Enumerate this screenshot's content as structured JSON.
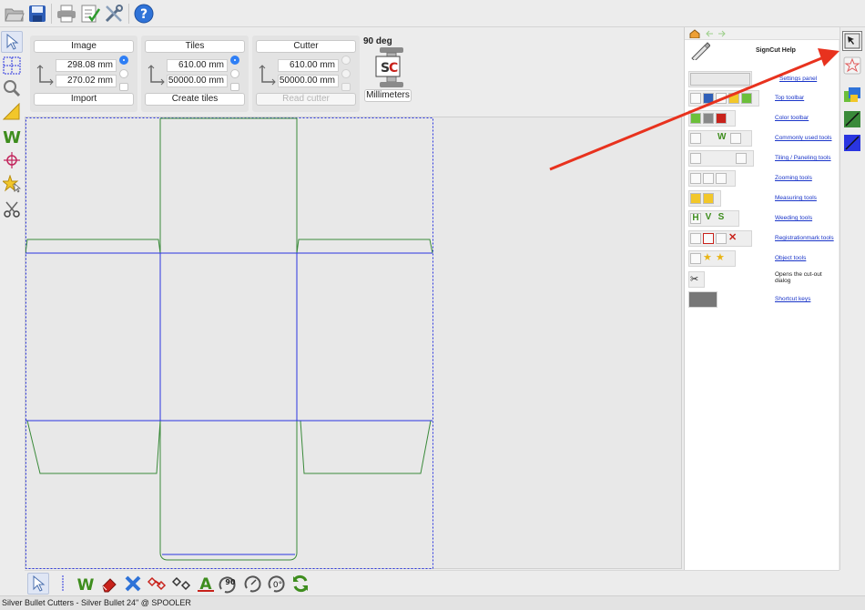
{
  "setup_panel": {
    "image": {
      "label": "Image",
      "width": "298.08 mm",
      "height": "270.02 mm",
      "action": "Import"
    },
    "tiles": {
      "label": "Tiles",
      "width": "610.00 mm",
      "height": "50000.00 mm",
      "action": "Create tiles"
    },
    "cutter": {
      "label": "Cutter",
      "width": "610.00 mm",
      "height": "50000.00 mm",
      "action": "Read cutter"
    },
    "orientation": "90 deg",
    "units": "Millimeters"
  },
  "help": {
    "title": "SignCut Help",
    "items": [
      "Settings panel",
      "Top toolbar",
      "Color toolbar",
      "Commonly used tools",
      "Tiling / Paneling tools",
      "Zooming tools",
      "Measuring tools",
      "Weeding tools",
      "Registrationmark tools",
      "Object tools",
      "Opens the cut-out dialog",
      "Shortcut keys"
    ]
  },
  "bottom_toolbar": {
    "rotate_90_label": "90",
    "rotate_0_label": "0°"
  },
  "status": "Silver Bullet Cutters - Silver Bullet 24\" @ SPOOLER",
  "colors": {
    "accent": "#2f7ff5",
    "tile_line": "#2a35e0",
    "cut_line": "#3a8a3a",
    "annotation_arrow": "#e8321e",
    "help_link": "#1a35c9"
  }
}
